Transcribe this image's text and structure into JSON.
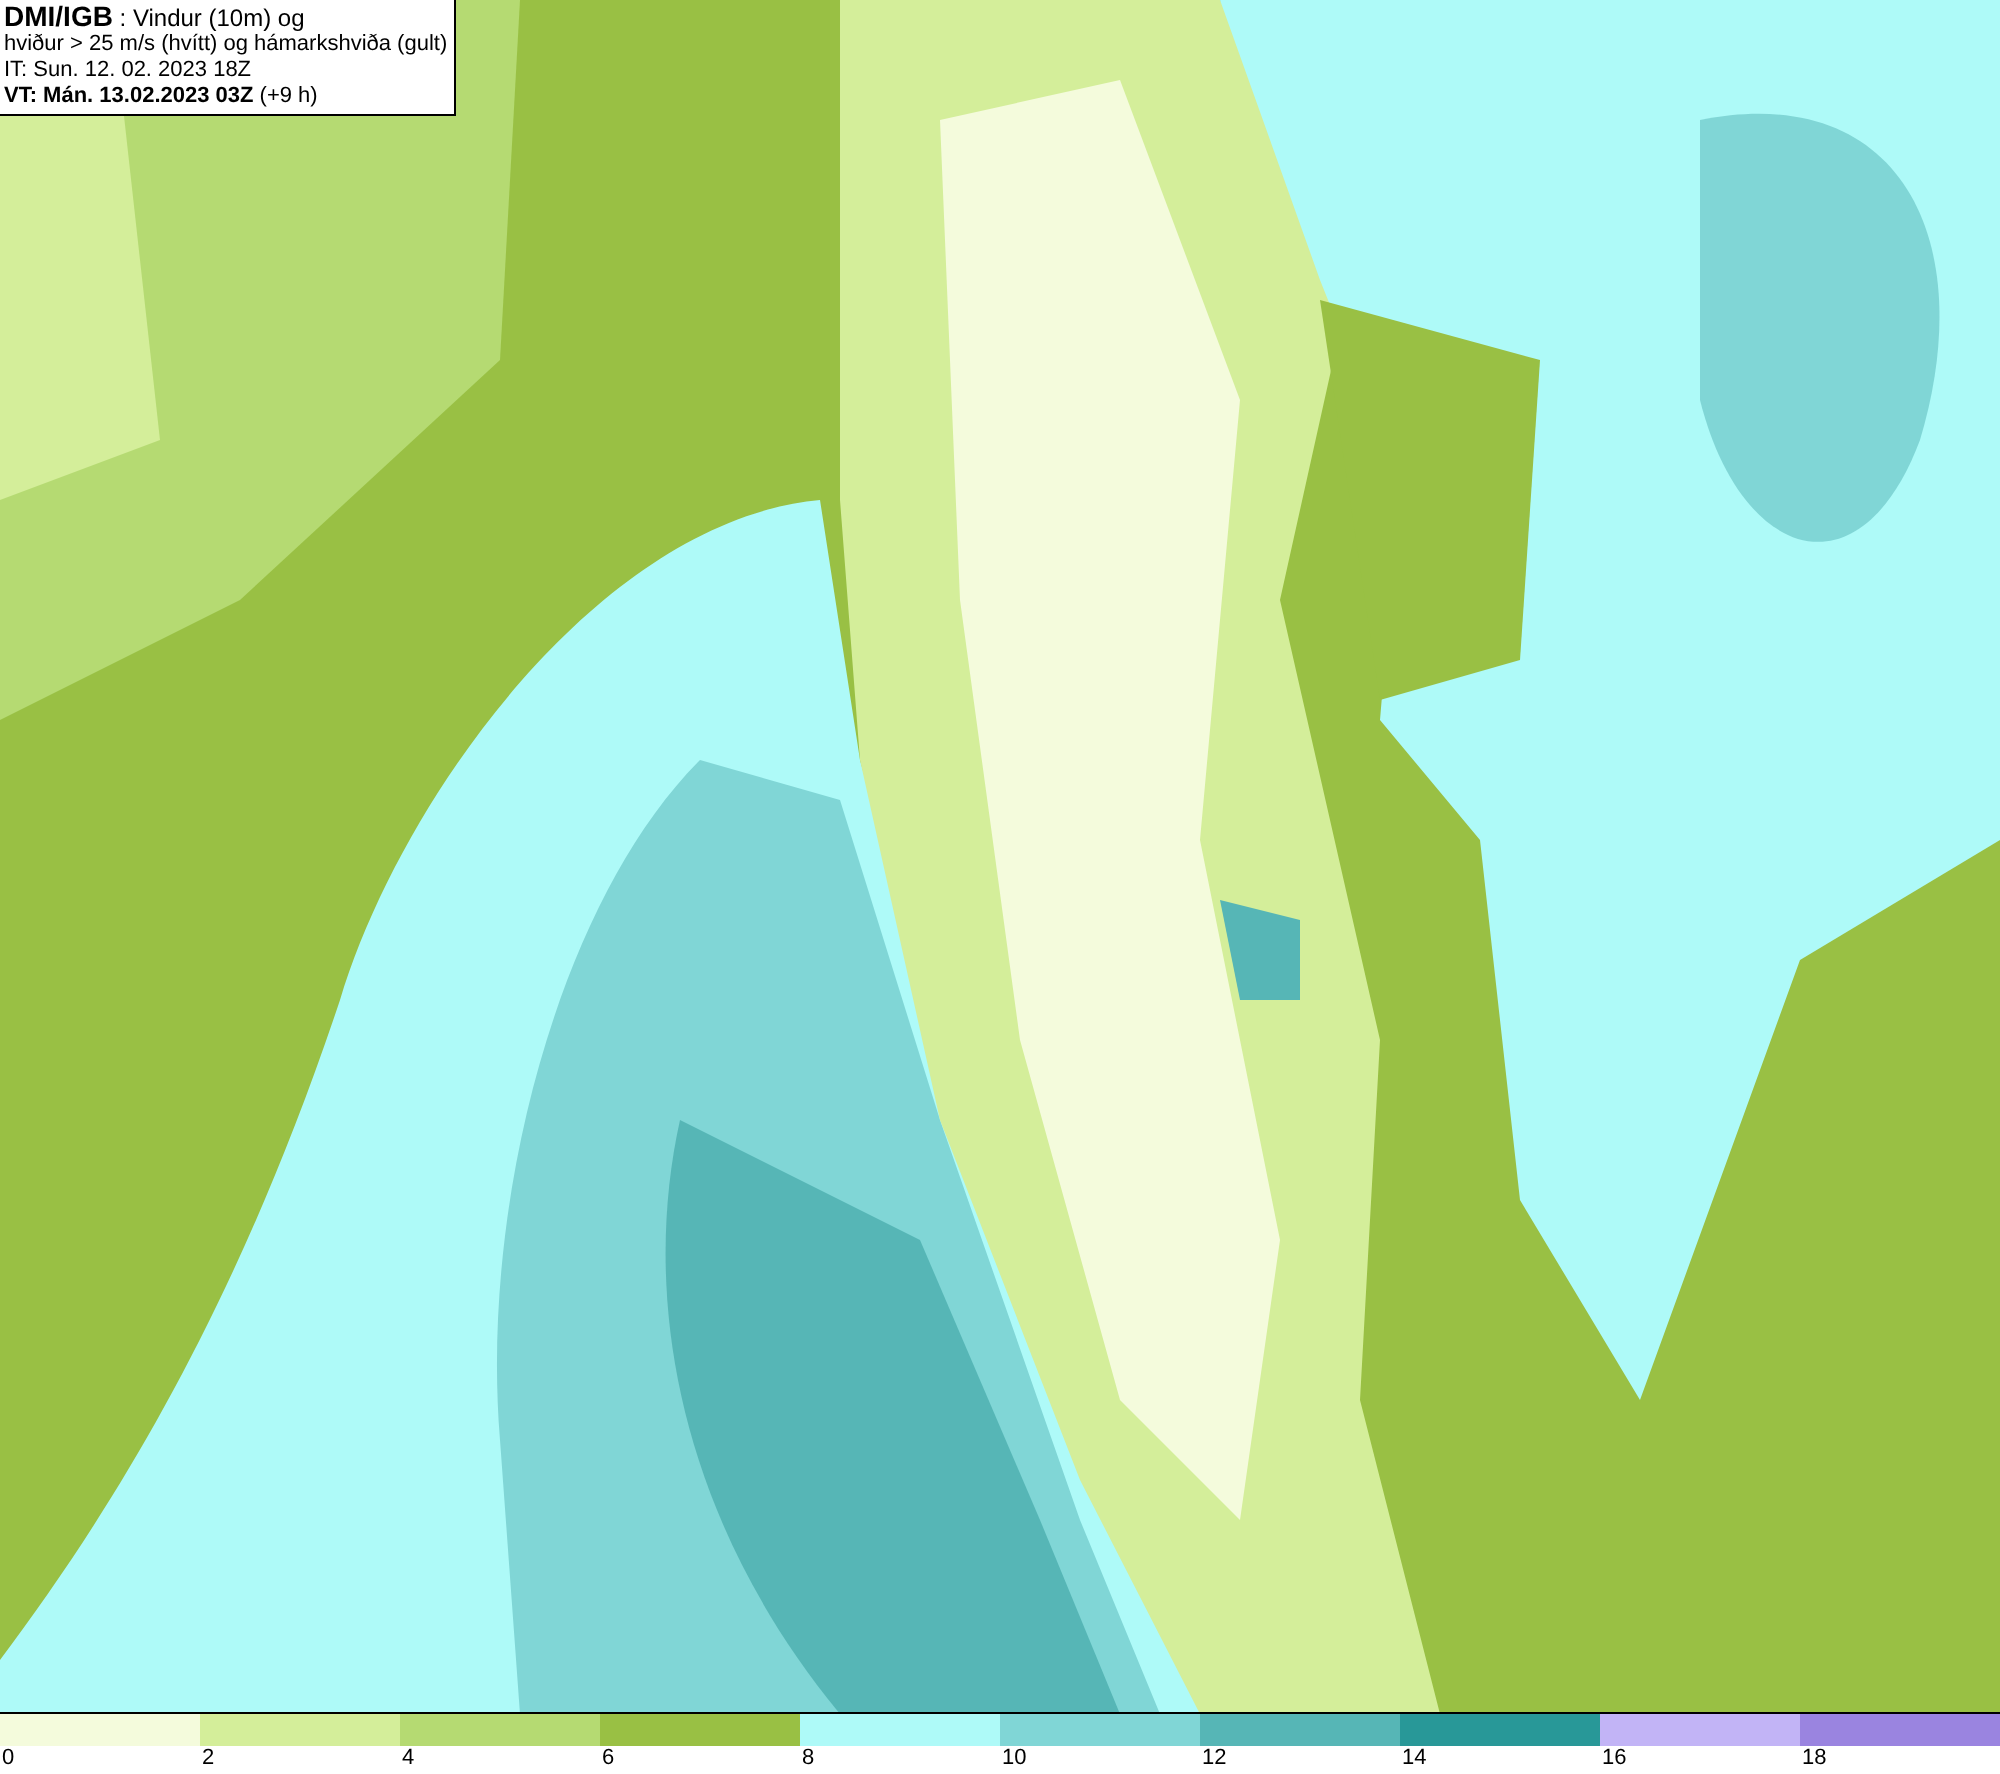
{
  "info_box": {
    "lines": [
      "**DMI/IGB** : Vindur (10m) og",
      "hviður > 25 m/s (hvítt) og hámarkshviða (gult)",
      "IT: Sun. 12. 02. 2023 18Z",
      "**VT: Mán. 13.02.2023 03Z** (+9 h)"
    ]
  },
  "legend": [
    {
      "label": "0",
      "color": "#f4fbdc"
    },
    {
      "label": "2",
      "color": "#d4ee9a"
    },
    {
      "label": "4",
      "color": "#b5da72"
    },
    {
      "label": "6",
      "color": "#99c044"
    },
    {
      "label": "8",
      "color": "#aefaf8"
    },
    {
      "label": "10",
      "color": "#80d6d6"
    },
    {
      "label": "12",
      "color": "#56b6b6"
    },
    {
      "label": "14",
      "color": "#289898"
    },
    {
      "label": "16",
      "color": "#c2b4f6"
    },
    {
      "label": "18",
      "color": "#9a84e0"
    }
  ]
}
